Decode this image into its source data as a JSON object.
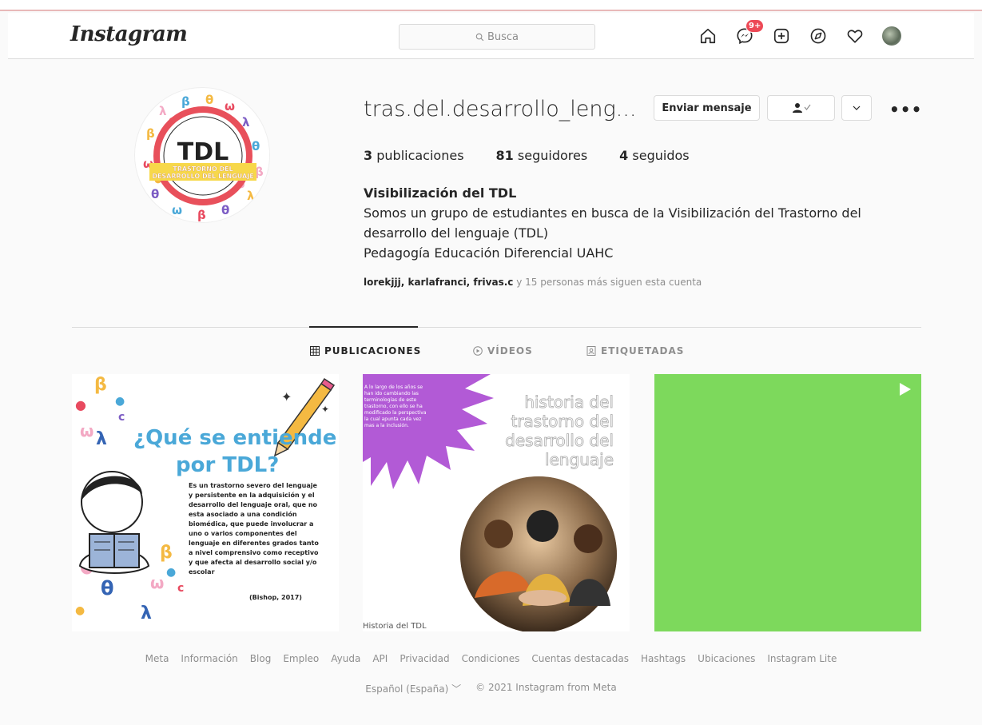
{
  "header": {
    "logo": "Instagram",
    "search_placeholder": "Busca",
    "messenger_badge": "9+"
  },
  "profile": {
    "username": "tras.del.desarrollo_leng...",
    "buttons": {
      "message": "Enviar mensaje"
    },
    "stats": [
      {
        "value": "3",
        "label": "publicaciones"
      },
      {
        "value": "81",
        "label": "seguidores"
      },
      {
        "value": "4",
        "label": "seguidos"
      }
    ],
    "bio": {
      "name": "Visibilización del TDL",
      "line1": "Somos un grupo de estudiantes en busca de la Visibilización del Trastorno del",
      "line2": "desarrollo del lenguaje (TDL)",
      "line3": "Pedagogía Educación Diferencial UAHC"
    },
    "followed_by": {
      "users": "lorekjjj, karlafranci, frivas.c",
      "rest": " y 15 personas más siguen esta cuenta"
    },
    "pic_text": {
      "big": "TDL",
      "ribbon1": "TRASTORNO DEL",
      "ribbon2": "DESARROLLO DEL LENGUAJE"
    }
  },
  "tabs": [
    {
      "label": "PUBLICACIONES",
      "icon": "grid-icon",
      "active": true
    },
    {
      "label": "VÍDEOS",
      "icon": "video-icon",
      "active": false
    },
    {
      "label": "ETIQUETADAS",
      "icon": "tagged-icon",
      "active": false
    }
  ],
  "posts": {
    "post1": {
      "title1": "¿Qué se entiende",
      "title2": "por TDL?",
      "body": [
        "Es un trastorno severo del lenguaje",
        "y persistente en la adquisición y el",
        "desarrollo del lenguaje oral, que no",
        "esta asociado a una condición",
        "biomédica, que puede involucrar a",
        "uno o varios componentes del",
        "lenguaje en diferentes grados tanto",
        "a nivel comprensivo como receptivo",
        "y que afecta al desarrollo social y/o",
        "escolar"
      ],
      "cite": "(Bishop, 2017)"
    },
    "post2": {
      "title": [
        "historia del",
        "trastorno del",
        "desarrollo del",
        "lenguaje"
      ],
      "burst_text": [
        "A lo largo de los años se",
        "han ido cambiando las",
        "terminologías de este",
        "trastorno, con ello se ha",
        "modificado la perspectiva",
        "la cual apunta cada vez",
        "mas a la inclusión."
      ],
      "caption": "Historia del TDL"
    },
    "post3": {
      "type": "video",
      "color": "#7dd95c"
    }
  },
  "footer": {
    "links": [
      "Meta",
      "Información",
      "Blog",
      "Empleo",
      "Ayuda",
      "API",
      "Privacidad",
      "Condiciones",
      "Cuentas destacadas",
      "Hashtags",
      "Ubicaciones",
      "Instagram Lite"
    ],
    "language": "Español (España)",
    "copyright": "© 2021 Instagram from Meta"
  }
}
